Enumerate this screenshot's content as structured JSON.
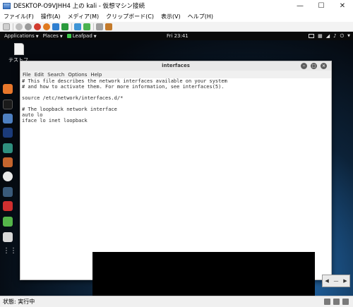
{
  "host": {
    "title": "DESKTOP-O9VJHH4 上の kali - 仮想マシン接続",
    "menu": [
      "ファイル(F)",
      "操作(A)",
      "メディア(M)",
      "クリップボード(C)",
      "表示(V)",
      "ヘルプ(H)"
    ],
    "status": "状態: 実行中"
  },
  "kali": {
    "applications": "Applications",
    "places": "Places",
    "app": "Leafpad",
    "clock": "Fri 23:41",
    "desktop_file": "テストフ..."
  },
  "leafpad": {
    "title": "interfaces",
    "menu": [
      "File",
      "Edit",
      "Search",
      "Options",
      "Help"
    ],
    "lines": [
      "# This file describes the network interfaces available on your system",
      "# and how to activate them. For more information, see interfaces(5).",
      " ",
      "source /etc/network/interfaces.d/*",
      " ",
      "# The loopback network interface",
      "auto lo",
      "iface lo inet loopback"
    ]
  }
}
